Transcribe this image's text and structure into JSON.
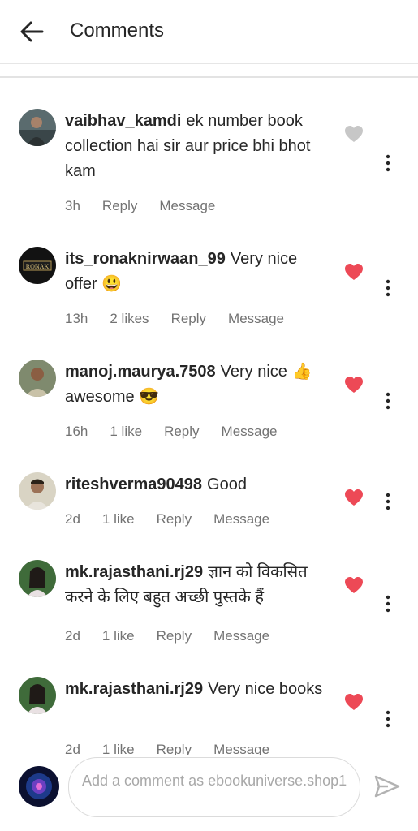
{
  "header": {
    "title": "Comments"
  },
  "comments": [
    {
      "username": "vaibhav_kamdi",
      "text": "ek number book collection hai sir aur price bhi bhot kam",
      "time": "3h",
      "likes": "",
      "reply": "Reply",
      "message": "Message",
      "liked": false
    },
    {
      "username": "its_ronaknirwaan_99",
      "text": "Very nice offer 😃",
      "time": "13h",
      "likes": "2 likes",
      "reply": "Reply",
      "message": "Message",
      "liked": true,
      "avatar_text": "RONAK"
    },
    {
      "username": "manoj.maurya.7508",
      "text": "Very nice 👍 awesome 😎",
      "time": "16h",
      "likes": "1 like",
      "reply": "Reply",
      "message": "Message",
      "liked": true
    },
    {
      "username": "riteshverma90498",
      "text": "Good",
      "time": "2d",
      "likes": "1 like",
      "reply": "Reply",
      "message": "Message",
      "liked": true
    },
    {
      "username": "mk.rajasthani.rj29",
      "text": "ज्ञान को विकसित करने के लिए बहुत अच्छी पुस्तके हैं",
      "time": "2d",
      "likes": "1 like",
      "reply": "Reply",
      "message": "Message",
      "liked": true
    },
    {
      "username": "mk.rajasthani.rj29",
      "text": "Very nice books",
      "time": "2d",
      "likes": "1 like",
      "reply": "Reply",
      "message": "Message",
      "liked": true
    }
  ],
  "composer": {
    "placeholder": "Add a comment as ebookuniverse.shop1"
  },
  "colors": {
    "heart_liked": "#ed4956",
    "heart_unliked": "#c7c7c7",
    "meta": "#737373",
    "send": "#b2b2b2"
  }
}
